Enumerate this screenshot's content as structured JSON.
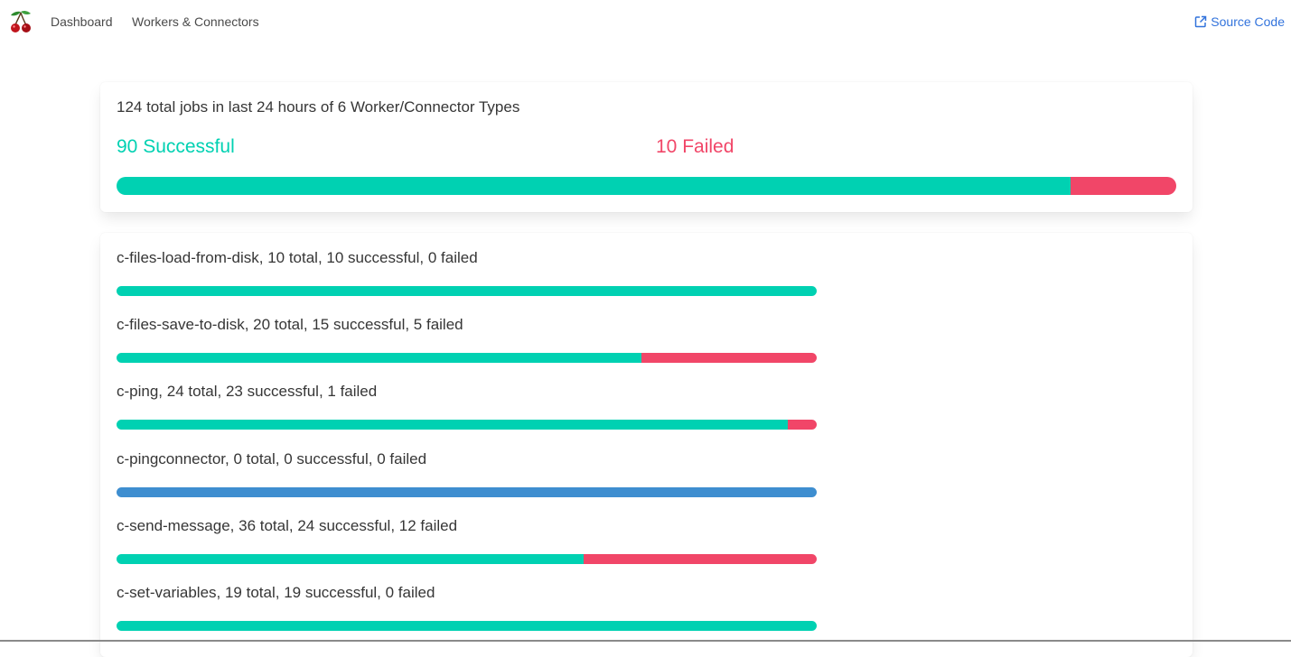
{
  "nav": {
    "logo": "cherry-icon",
    "dashboard_label": "Dashboard",
    "workers_label": "Workers & Connectors",
    "source_label": "Source Code",
    "source_icon": "external-link-icon"
  },
  "colors": {
    "success": "#00d1b2",
    "failed": "#f14668",
    "empty": "#3e8ed0",
    "link": "#3273dc"
  },
  "summary": {
    "title": "124 total jobs in last 24 hours of 6 Worker/Connector Types",
    "successful_label": "90 Successful",
    "failed_label": "10 Failed",
    "successful": 90,
    "failed": 10,
    "successful_fraction": 0.9
  },
  "workers": [
    {
      "label": "c-files-load-from-disk, 10 total, 10 successful, 0 failed",
      "total": 10,
      "successful": 10,
      "failed": 0
    },
    {
      "label": "c-files-save-to-disk, 20 total, 15 successful, 5 failed",
      "total": 20,
      "successful": 15,
      "failed": 5
    },
    {
      "label": "c-ping, 24 total, 23 successful, 1 failed",
      "total": 24,
      "successful": 23,
      "failed": 1
    },
    {
      "label": "c-pingconnector, 0 total, 0 successful, 0 failed",
      "total": 0,
      "successful": 0,
      "failed": 0
    },
    {
      "label": "c-send-message, 36 total, 24 successful, 12 failed",
      "total": 36,
      "successful": 24,
      "failed": 12
    },
    {
      "label": "c-set-variables, 19 total, 19 successful, 0 failed",
      "total": 19,
      "successful": 19,
      "failed": 0
    }
  ]
}
